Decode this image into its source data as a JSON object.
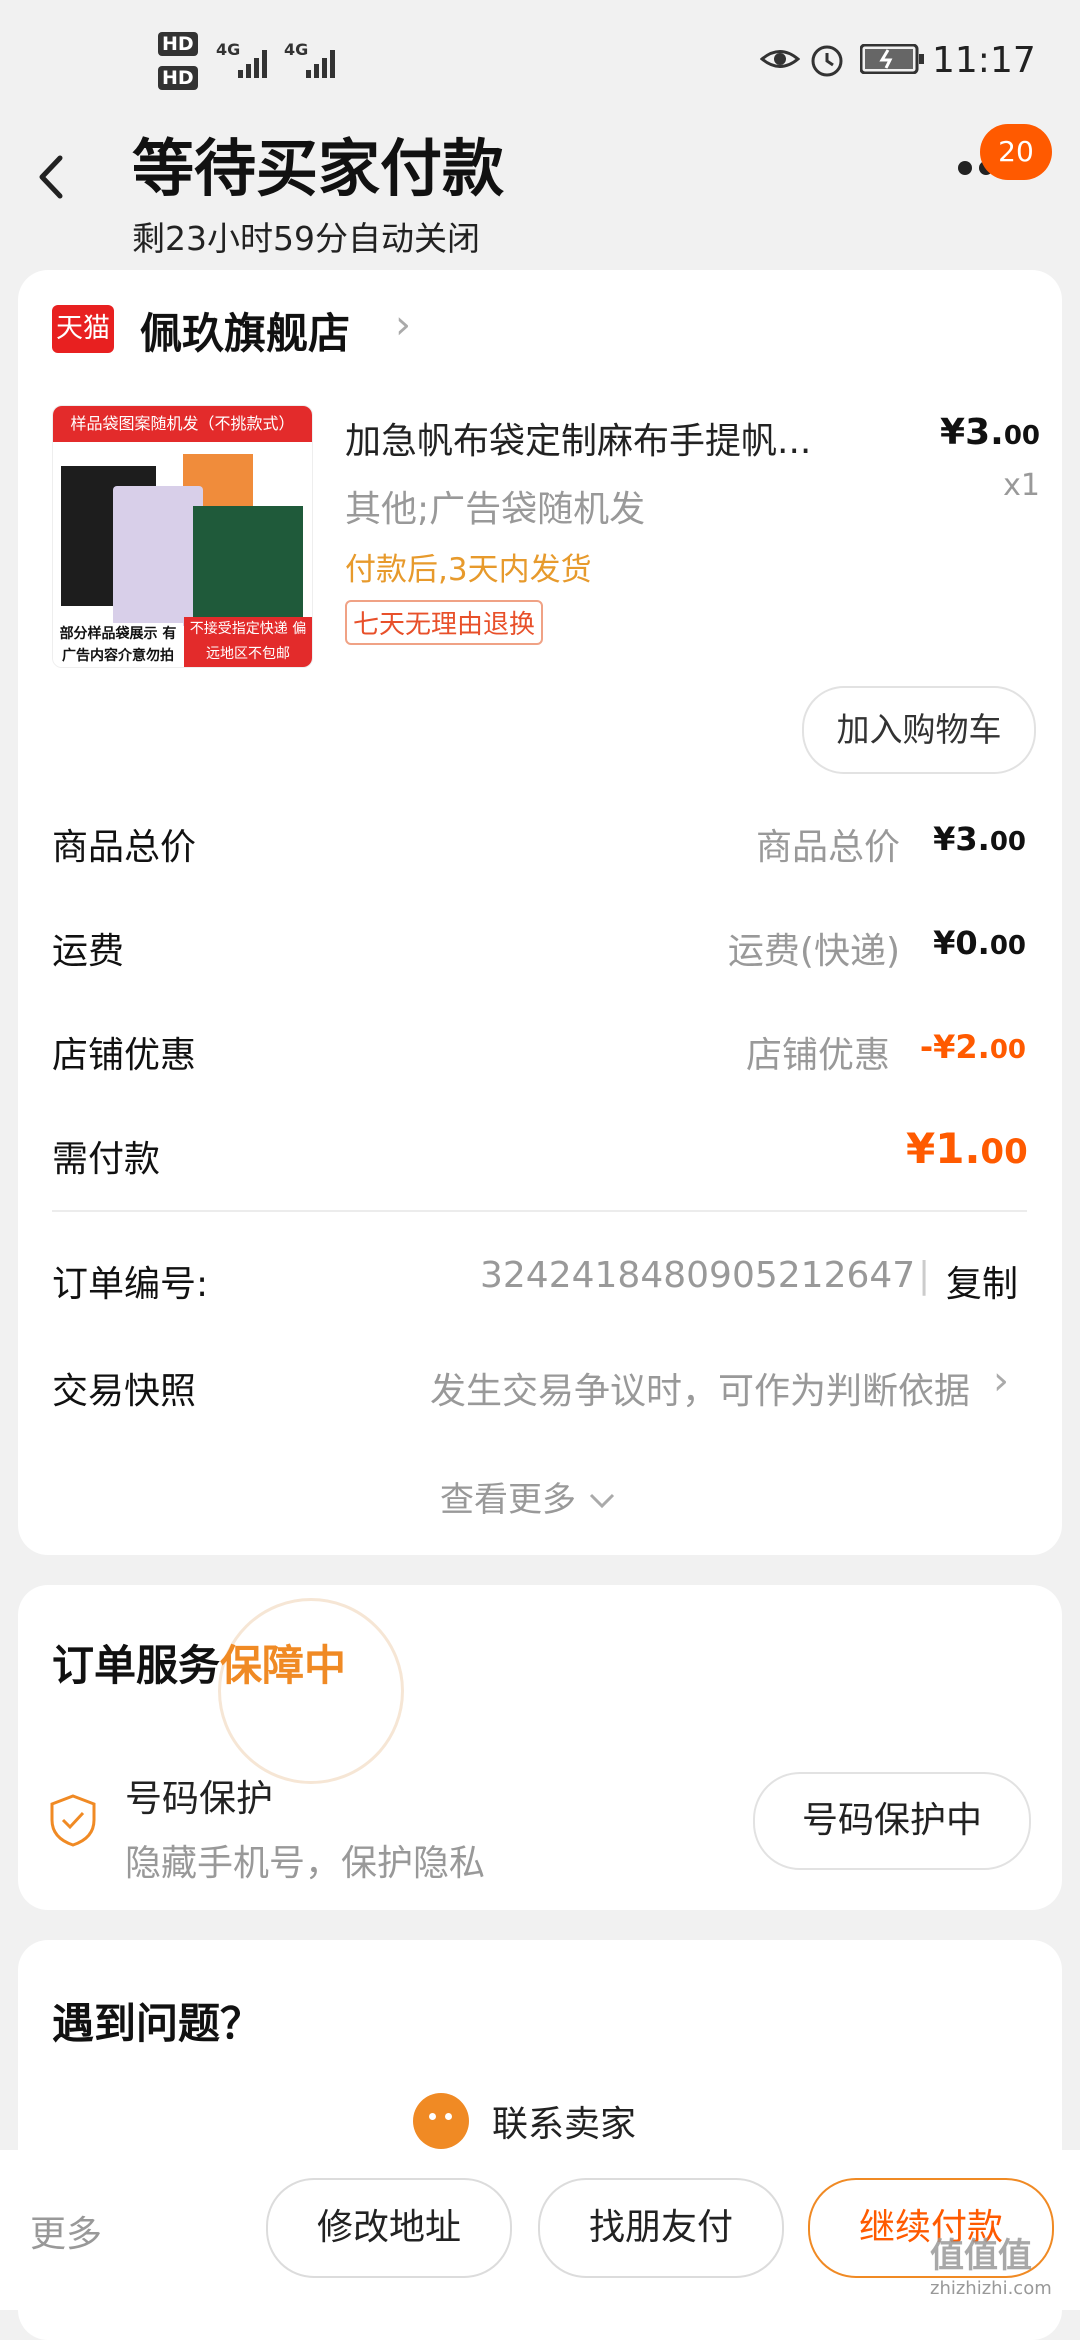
{
  "status_bar": {
    "hd1": "HD",
    "hd2": "HD",
    "net1": "4G",
    "net2": "4G",
    "time": "11:17",
    "icons": [
      "eye-icon",
      "alarm-icon",
      "battery-icon"
    ]
  },
  "header": {
    "title": "等待买家付款",
    "subtitle": "剩23小时59分自动关闭",
    "badge_count": "20"
  },
  "shop": {
    "logo_text": "天猫",
    "name": "佩玖旗舰店"
  },
  "product": {
    "image_top": "样品袋图案随机发（不挑款式）",
    "image_bottom_left": "部分样品袋展示 有广告内容介意勿拍",
    "image_bottom_right": "不接受指定快递 偏远地区不包邮",
    "name": "加急帆布袋定制麻布手提帆...",
    "spec": "其他;广告袋随机发",
    "shipping": "付款后,3天内发货",
    "tag": "七天无理由退换",
    "price_main": "¥3.",
    "price_dec": "00",
    "qty": "x1",
    "add_cart": "加入购物车"
  },
  "summary": {
    "rows": [
      {
        "label": "商品总价",
        "sub": "商品总价",
        "val_main": "¥3.",
        "val_dec": "00"
      },
      {
        "label": "运费",
        "sub": "运费(快递)",
        "val_main": "¥0.",
        "val_dec": "00"
      },
      {
        "label": "店铺优惠",
        "sub": "店铺优惠",
        "val_main": "-¥2.",
        "val_dec": "00"
      },
      {
        "label": "需付款",
        "sub": "",
        "val_main": "¥1.",
        "val_dec": "00"
      }
    ]
  },
  "order": {
    "number_label": "订单编号:",
    "number": "3242418480905212647",
    "separator": "|",
    "copy": "复制",
    "snapshot_label": "交易快照",
    "snapshot_hint": "发生交易争议时，可作为判断依据",
    "view_more": "查看更多"
  },
  "service": {
    "title": "订单服务",
    "title_highlight": "保障中",
    "number_title": "号码保护",
    "number_desc": "隐藏手机号，保护隐私",
    "number_btn": "号码保护中"
  },
  "problem": {
    "title": "遇到问题？",
    "contact": "联系卖家"
  },
  "bottom_bar": {
    "more": "更多",
    "modify_address": "修改地址",
    "friend_pay": "找朋友付",
    "continue_pay": "继续付款"
  },
  "watermark": {
    "text": "值值值",
    "url": "zhizhizhi.com"
  },
  "colors": {
    "accent": "#ff5a00",
    "gold": "#f08a24",
    "tmall_red": "#e82020"
  }
}
